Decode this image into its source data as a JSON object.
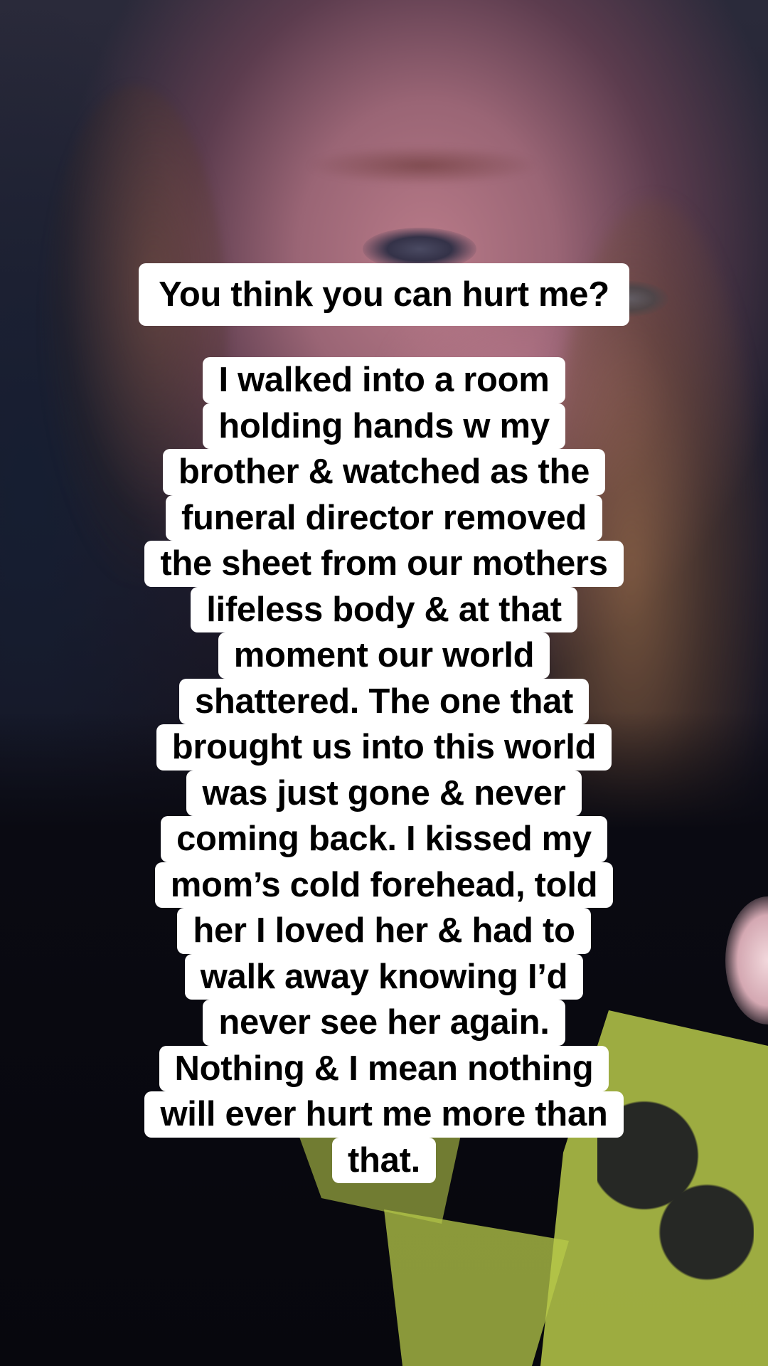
{
  "overlay": {
    "title": "You think you can hurt me?",
    "body_lines": [
      "I walked into a room",
      "holding hands w my",
      "brother & watched as the",
      "funeral director removed",
      "the sheet from our mothers",
      "lifeless body & at that",
      "moment our world",
      "shattered. The one that",
      "brought us into this world",
      "was just gone & never",
      "coming back. I kissed my",
      "mom’s cold forehead, told",
      "her I loved her & had to",
      "walk away knowing I’d",
      "never see her again.",
      "Nothing & I mean nothing",
      "will ever hurt me more than",
      "that."
    ]
  },
  "colors": {
    "caption_background": "#ffffff",
    "caption_text": "#000000"
  }
}
